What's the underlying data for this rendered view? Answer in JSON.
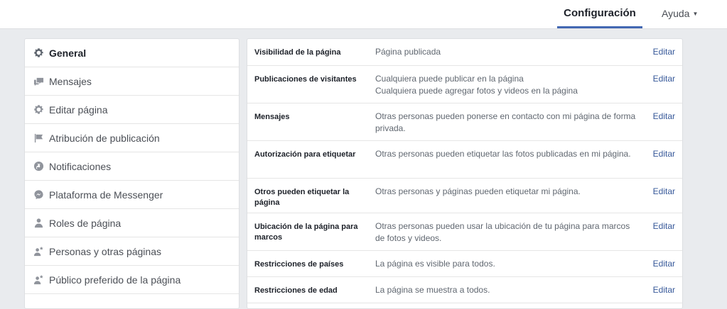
{
  "header": {
    "tab_settings": "Configuración",
    "tab_help": "Ayuda"
  },
  "sidebar": {
    "items": [
      {
        "label": "General",
        "icon": "gear-icon"
      },
      {
        "label": "Mensajes",
        "icon": "messages-icon"
      },
      {
        "label": "Editar página",
        "icon": "gear-icon"
      },
      {
        "label": "Atribución de publicación",
        "icon": "flag-icon"
      },
      {
        "label": "Notificaciones",
        "icon": "globe-icon"
      },
      {
        "label": "Plataforma de Messenger",
        "icon": "messenger-icon"
      },
      {
        "label": "Roles de página",
        "icon": "person-icon"
      },
      {
        "label": "Personas y otras páginas",
        "icon": "person-star-icon"
      },
      {
        "label": "Público preferido de la página",
        "icon": "person-star-icon"
      }
    ]
  },
  "settings": {
    "edit_label": "Editar",
    "rows": [
      {
        "label": "Visibilidad de la página",
        "value": [
          "Página publicada"
        ]
      },
      {
        "label": "Publicaciones de visitantes",
        "value": [
          "Cualquiera puede publicar en la página",
          "Cualquiera puede agregar fotos y videos en la página"
        ]
      },
      {
        "label": "Mensajes",
        "value": [
          "Otras personas pueden ponerse en contacto con mi página de forma privada."
        ]
      },
      {
        "label": "Autorización para etiquetar",
        "value": [
          "Otras personas pueden etiquetar las fotos publicadas en mi página."
        ]
      },
      {
        "label": "Otros pueden etiquetar la página",
        "value": [
          "Otras personas y páginas pueden etiquetar mi página."
        ]
      },
      {
        "label": "Ubicación de la página para marcos",
        "value": [
          "Otras personas pueden usar la ubicación de tu página para marcos de fotos y videos."
        ]
      },
      {
        "label": "Restricciones de países",
        "value": [
          "La página es visible para todos."
        ]
      },
      {
        "label": "Restricciones de edad",
        "value": [
          "La página se muestra a todos."
        ]
      }
    ]
  }
}
